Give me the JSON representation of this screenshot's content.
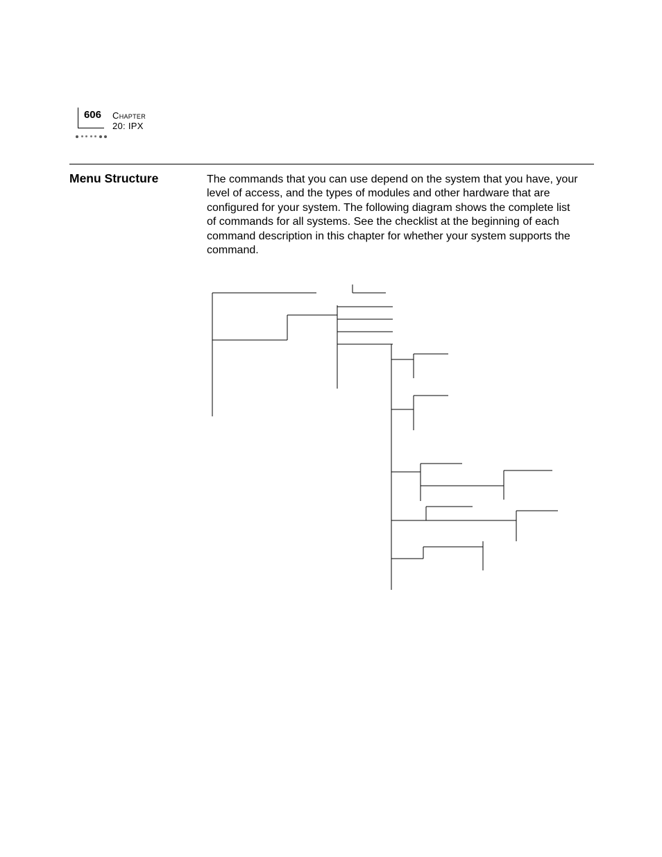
{
  "header": {
    "page_number": "606",
    "chapter_label": "Chapter 20: IPX"
  },
  "section": {
    "heading": "Menu Structure",
    "body": "The commands that you can use depend on the system that you have, your level of access, and the types of modules and other hardware that are configured for your system. The following diagram shows the complete list of commands for all systems. See the checklist at the beginning of each command description in this chapter for whether your system supports the command."
  }
}
